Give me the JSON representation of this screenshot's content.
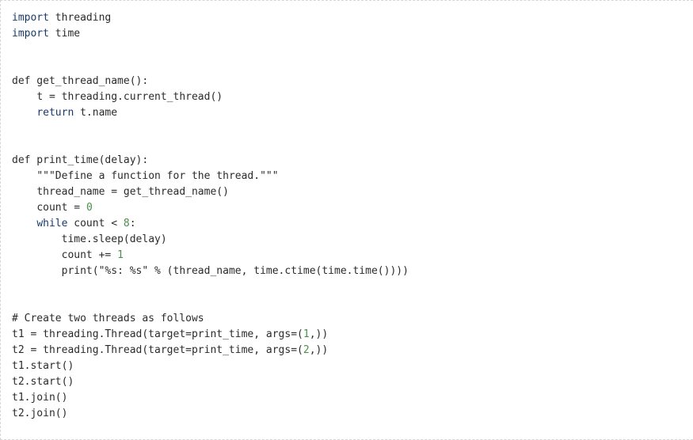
{
  "panel": {
    "title": "python-threading-code-snippet",
    "language": "python",
    "background_color": "#ffffff",
    "border_color": "#d6d6d6",
    "border_style": "dashed"
  },
  "theme": {
    "keyword_color": "#1a3a6b",
    "number_color": "#4a8f4a",
    "text_color": "#2b2b2b",
    "comment_color": "#2b2b2b",
    "string_color": "#2b2b2b"
  },
  "code": {
    "lines": [
      {
        "n": 1,
        "indent": 0,
        "tokens": [
          {
            "t": "import",
            "c": "kw"
          },
          {
            "t": " threading",
            "c": "txt"
          }
        ]
      },
      {
        "n": 2,
        "indent": 0,
        "tokens": [
          {
            "t": "import",
            "c": "kw"
          },
          {
            "t": " time",
            "c": "txt"
          }
        ]
      },
      {
        "n": 3,
        "indent": 0,
        "tokens": []
      },
      {
        "n": 4,
        "indent": 0,
        "tokens": []
      },
      {
        "n": 5,
        "indent": 0,
        "tokens": [
          {
            "t": "def get_thread_name():",
            "c": "txt"
          }
        ]
      },
      {
        "n": 6,
        "indent": 1,
        "tokens": [
          {
            "t": "t = threading.current_thread()",
            "c": "txt"
          }
        ]
      },
      {
        "n": 7,
        "indent": 1,
        "tokens": [
          {
            "t": "return",
            "c": "kw"
          },
          {
            "t": " t.name",
            "c": "txt"
          }
        ]
      },
      {
        "n": 8,
        "indent": 0,
        "tokens": []
      },
      {
        "n": 9,
        "indent": 0,
        "tokens": []
      },
      {
        "n": 10,
        "indent": 0,
        "tokens": [
          {
            "t": "def print_time(delay):",
            "c": "txt"
          }
        ]
      },
      {
        "n": 11,
        "indent": 1,
        "tokens": [
          {
            "t": "\"\"\"Define a function for the thread.\"\"\"",
            "c": "txt"
          }
        ]
      },
      {
        "n": 12,
        "indent": 1,
        "tokens": [
          {
            "t": "thread_name = get_thread_name()",
            "c": "txt"
          }
        ]
      },
      {
        "n": 13,
        "indent": 1,
        "tokens": [
          {
            "t": "count = ",
            "c": "txt"
          },
          {
            "t": "0",
            "c": "num"
          }
        ]
      },
      {
        "n": 14,
        "indent": 1,
        "tokens": [
          {
            "t": "while",
            "c": "kw"
          },
          {
            "t": " count < ",
            "c": "txt"
          },
          {
            "t": "8",
            "c": "num"
          },
          {
            "t": ":",
            "c": "txt"
          }
        ]
      },
      {
        "n": 15,
        "indent": 2,
        "tokens": [
          {
            "t": "time.sleep(delay)",
            "c": "txt"
          }
        ]
      },
      {
        "n": 16,
        "indent": 2,
        "tokens": [
          {
            "t": "count += ",
            "c": "txt"
          },
          {
            "t": "1",
            "c": "num"
          }
        ]
      },
      {
        "n": 17,
        "indent": 2,
        "tokens": [
          {
            "t": "print(\"%s: %s\" % (thread_name, time.ctime(time.time())))",
            "c": "txt"
          }
        ]
      },
      {
        "n": 18,
        "indent": 0,
        "tokens": []
      },
      {
        "n": 19,
        "indent": 0,
        "tokens": []
      },
      {
        "n": 20,
        "indent": 0,
        "tokens": [
          {
            "t": "# Create two threads as follows",
            "c": "txt"
          }
        ]
      },
      {
        "n": 21,
        "indent": 0,
        "tokens": [
          {
            "t": "t1 = threading.Thread(target=print_time, args=(",
            "c": "txt"
          },
          {
            "t": "1",
            "c": "num"
          },
          {
            "t": ",))",
            "c": "txt"
          }
        ]
      },
      {
        "n": 22,
        "indent": 0,
        "tokens": [
          {
            "t": "t2 = threading.Thread(target=print_time, args=(",
            "c": "txt"
          },
          {
            "t": "2",
            "c": "num"
          },
          {
            "t": ",))",
            "c": "txt"
          }
        ]
      },
      {
        "n": 23,
        "indent": 0,
        "tokens": [
          {
            "t": "t1.start()",
            "c": "txt"
          }
        ]
      },
      {
        "n": 24,
        "indent": 0,
        "tokens": [
          {
            "t": "t2.start()",
            "c": "txt"
          }
        ]
      },
      {
        "n": 25,
        "indent": 0,
        "tokens": [
          {
            "t": "t1.join()",
            "c": "txt"
          }
        ]
      },
      {
        "n": 26,
        "indent": 0,
        "tokens": [
          {
            "t": "t2.join()",
            "c": "txt"
          }
        ]
      }
    ]
  }
}
